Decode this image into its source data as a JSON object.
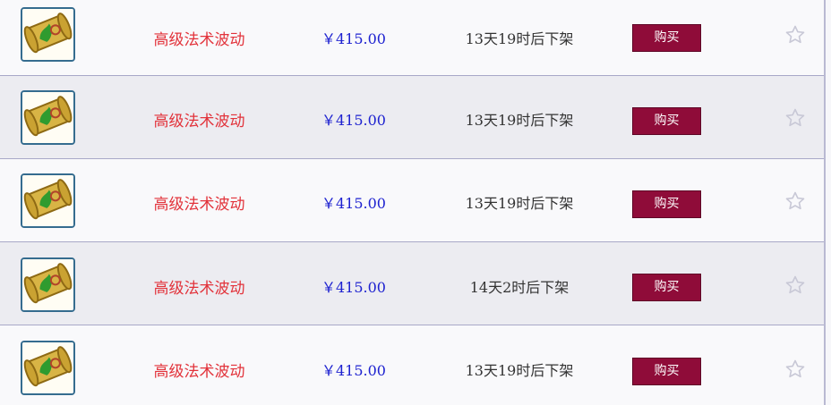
{
  "listings": [
    {
      "item_icon": "scroll-icon",
      "name": "高级法术波动",
      "price": "￥415.00",
      "time_left": "13天19时后下架",
      "buy_label": "购买",
      "favorite_icon": "star-outline-icon"
    },
    {
      "item_icon": "scroll-icon",
      "name": "高级法术波动",
      "price": "￥415.00",
      "time_left": "13天19时后下架",
      "buy_label": "购买",
      "favorite_icon": "star-outline-icon"
    },
    {
      "item_icon": "scroll-icon",
      "name": "高级法术波动",
      "price": "￥415.00",
      "time_left": "13天19时后下架",
      "buy_label": "购买",
      "favorite_icon": "star-outline-icon"
    },
    {
      "item_icon": "scroll-icon",
      "name": "高级法术波动",
      "price": "￥415.00",
      "time_left": "14天2时后下架",
      "buy_label": "购买",
      "favorite_icon": "star-outline-icon"
    },
    {
      "item_icon": "scroll-icon",
      "name": "高级法术波动",
      "price": "￥415.00",
      "time_left": "13天19时后下架",
      "buy_label": "购买",
      "favorite_icon": "star-outline-icon"
    }
  ],
  "colors": {
    "name_text": "#e2323a",
    "price_text": "#1e22d0",
    "buy_button_bg": "#8f0c39",
    "row_odd_bg": "#f9f9fb",
    "row_even_bg": "#ececf1"
  }
}
